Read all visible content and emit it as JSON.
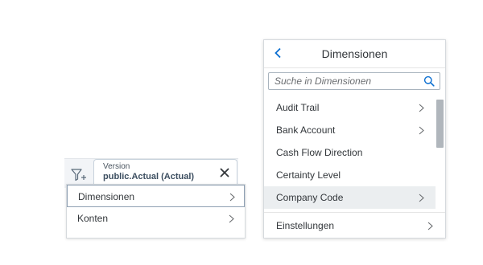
{
  "filter_bar": {
    "token": {
      "label": "Version",
      "value": "public.Actual (Actual)"
    }
  },
  "left_menu": {
    "items": [
      {
        "label": "Dimensionen",
        "active": true
      },
      {
        "label": "Konten",
        "active": false
      }
    ]
  },
  "dimension_popover": {
    "title": "Dimensionen",
    "search_placeholder": "Suche in Dimensionen",
    "items": [
      {
        "label": "Audit Trail",
        "has_children": true
      },
      {
        "label": "Bank Account",
        "has_children": true
      },
      {
        "label": "Cash Flow Direction",
        "has_children": false
      },
      {
        "label": "Certainty Level",
        "has_children": false
      },
      {
        "label": "Company Code",
        "has_children": true,
        "hover": true
      }
    ],
    "settings_label": "Einstellungen"
  },
  "icons": {
    "add_filter": "add-filter-icon",
    "close": "close-icon",
    "back": "chevron-left-icon",
    "search": "search-icon",
    "chevron": "chevron-right-icon"
  },
  "colors": {
    "accent": "#0a6ed1",
    "hover_row": "#ebeef0",
    "border": "#d5d9dd"
  }
}
